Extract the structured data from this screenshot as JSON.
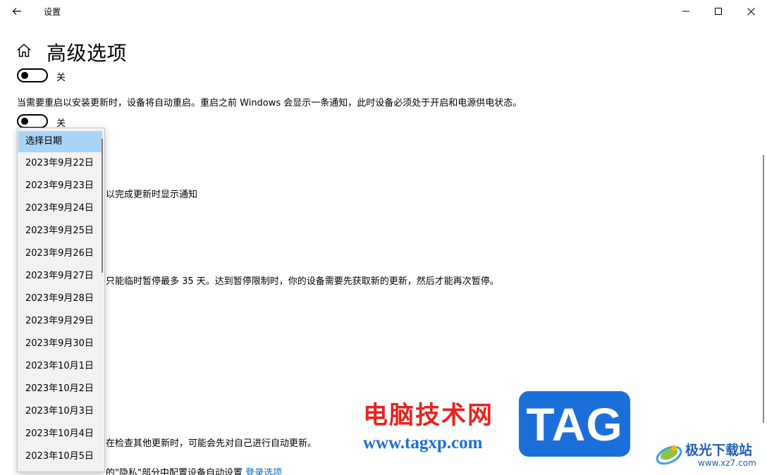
{
  "window": {
    "title": "设置"
  },
  "header": {
    "title": "高级选项"
  },
  "toggles": [
    {
      "state_label": "关"
    },
    {
      "state_label": "关"
    }
  ],
  "content": {
    "restart_description": "当需要重启以安装更新时，设备将自动重启。重启之前 Windows 会显示一条通知，此时设备必须处于开启和电源供电状态。",
    "notify_partial": "以完成更新时显示通知",
    "pause_partial": "只能临时暂停最多 35 天。达到暂停限制时，你的设备需要先获取新的更新，然后才能再次暂停。",
    "self_update_partial": "在检查其他更新时，可能会先对自己进行自动更新。",
    "privacy_partial": "的\"隐私\"部分中配置设备自动设置",
    "privacy_link": "登录选项"
  },
  "dropdown": {
    "options": [
      "选择日期",
      "2023年9月22日",
      "2023年9月23日",
      "2023年9月24日",
      "2023年9月25日",
      "2023年9月26日",
      "2023年9月27日",
      "2023年9月28日",
      "2023年9月29日",
      "2023年9月30日",
      "2023年10月1日",
      "2023年10月2日",
      "2023年10月3日",
      "2023年10月4日",
      "2023年10月5日"
    ],
    "selected_index": 0
  },
  "watermark": {
    "site_name": "电脑技术网",
    "site_url": "www.tagxp.com",
    "tag": "TAG",
    "brand2_name": "极光下载站",
    "brand2_url": "www.xz7.com"
  },
  "colors": {
    "selected_bg": "#a8d4f8",
    "link": "#0067c0",
    "watermark_red": "#e8231e",
    "watermark_blue": "#1c6fd9"
  }
}
